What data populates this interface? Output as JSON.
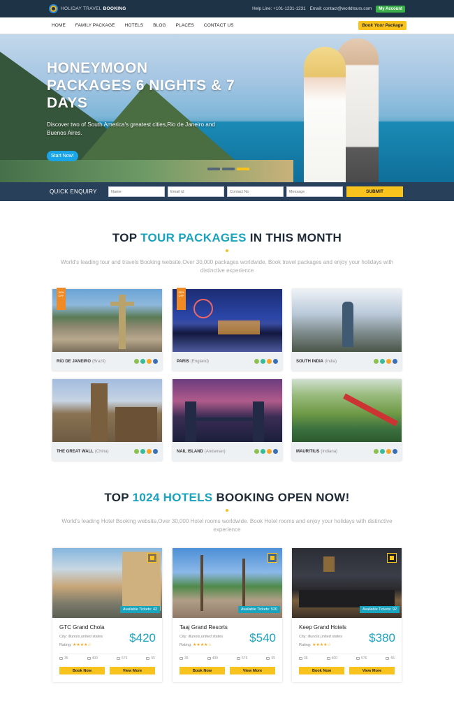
{
  "brand": {
    "name_light": "HOLIDAY TRAVEL",
    "name_bold": "BOOKING"
  },
  "topbar": {
    "help_line": "Help Line: +101-1231-1231",
    "email": "Email: contact@worldtours.com",
    "account_label": "My Account"
  },
  "nav": {
    "items": [
      "HOME",
      "FAMILY PACKAGE",
      "HOTELS",
      "BLOG",
      "PLACES",
      "CONTACT US"
    ],
    "cta": "Book Your Package"
  },
  "hero": {
    "title": "HONEYMOON PACKAGES 6 NIGHTS & 7 DAYS",
    "subtitle": "Discover two of South America's greatest cities,Rio de Janeiro and Buenos Aires.",
    "button": "Start Now!"
  },
  "enquiry": {
    "title": "QUICK ENQUIRY",
    "placeholders": {
      "name": "Name",
      "email": "Email id",
      "contact": "Contact No",
      "message": "Message"
    },
    "submit": "SUBMIT"
  },
  "packages_section": {
    "title_pre": "TOP ",
    "title_hl": "TOUR PACKAGES",
    "title_post": " IN THIS MONTH",
    "subtitle": "World's leading tour and travels Booking website,Over 30,000 packages worldwide. Book travel packages and enjoy your holidays with distinctive experience",
    "packages": [
      {
        "place": "RIO DE JANEIRO",
        "country": "(Brazil)",
        "badge": "30% OFF"
      },
      {
        "place": "PARIS",
        "country": "(England)",
        "badge": "50% OFF"
      },
      {
        "place": "SOUTH INDIA",
        "country": "(India)",
        "badge": ""
      },
      {
        "place": "THE GREAT WALL",
        "country": "(China)",
        "badge": ""
      },
      {
        "place": "NAIL ISLAND",
        "country": "(Andaman)",
        "badge": ""
      },
      {
        "place": "MAURITIUS",
        "country": "(Indiana)",
        "badge": ""
      }
    ]
  },
  "hotels_section": {
    "title_pre": "TOP ",
    "title_hl": "1024 HOTELS",
    "title_post": " BOOKING OPEN NOW!",
    "subtitle": "World's leading Hotel Booking website,Over 30,000 Hotel rooms worldwide. Book Hotel rooms and enjoy your holidays with distinctive experience",
    "hotels": [
      {
        "name": "GTC Grand Chola",
        "city": "City: illunois,united states",
        "rating_label": "Rating:",
        "stars": "★★★★☆",
        "price": "$420",
        "tickets": "Available Tickets: 42",
        "stats": [
          "35",
          "400",
          "576",
          "55"
        ],
        "book": "Book Now",
        "view": "View More"
      },
      {
        "name": "Taaj Grand Resorts",
        "city": "City: illunois,united states",
        "rating_label": "Rating:",
        "stars": "★★★★☆",
        "price": "$540",
        "tickets": "Available Tickets: 520",
        "stats": [
          "35",
          "400",
          "576",
          "55"
        ],
        "book": "Book Now",
        "view": "View More"
      },
      {
        "name": "Keep Grand Hotels",
        "city": "City: illunois,united states",
        "rating_label": "Rating:",
        "stars": "★★★★☆",
        "price": "$380",
        "tickets": "Available Tickets: 92",
        "stats": [
          "36",
          "400",
          "576",
          "55"
        ],
        "book": "Book Now",
        "view": "View More"
      }
    ]
  },
  "colors": {
    "accent": "#1aa3bd",
    "cta_yellow": "#f8c31d",
    "header_dark": "#1f3346",
    "enquiry_bg": "#28405a"
  }
}
